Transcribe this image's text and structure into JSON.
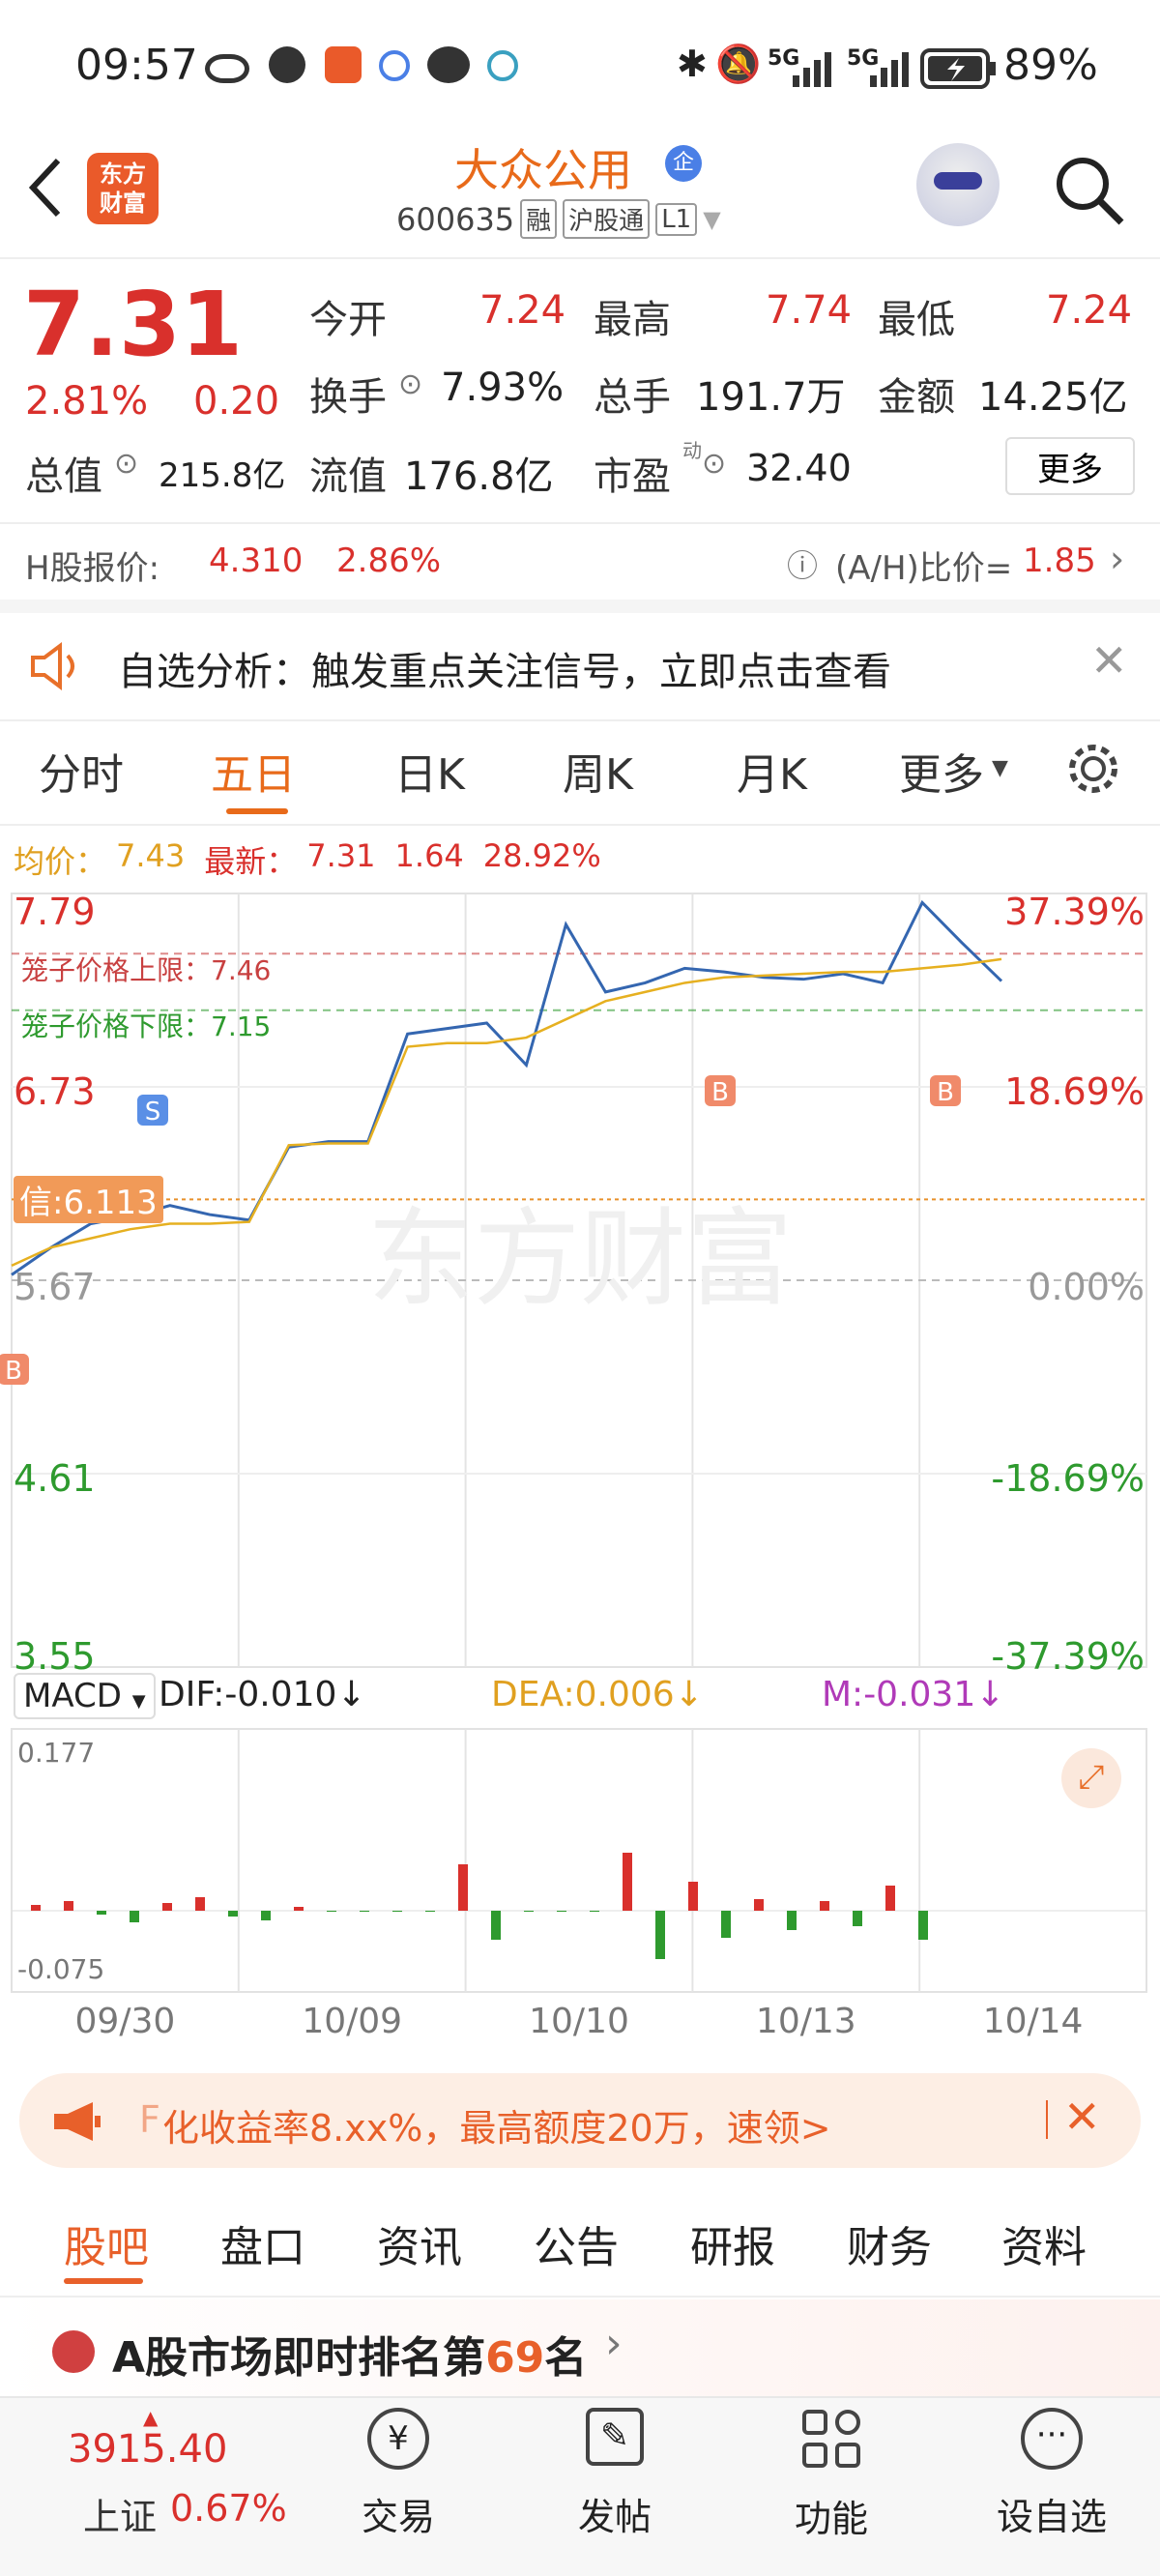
{
  "status_bar": {
    "time": "09:57",
    "battery": "89%",
    "signal1": "5G",
    "signal2": "5G"
  },
  "header": {
    "logo_text_1": "东方",
    "logo_text_2": "财富",
    "name": "大众公用",
    "name_badge": "企",
    "code": "600635",
    "tags": [
      "融",
      "沪股通",
      "L1"
    ]
  },
  "quote": {
    "price": "7.31",
    "change_pct": "2.81%",
    "change_abs": "0.20",
    "open_label": "今开",
    "open": "7.24",
    "high_label": "最高",
    "high": "7.74",
    "low_label": "最低",
    "low": "7.24",
    "turnover_label": "换手",
    "turnover": "7.93%",
    "volume_label": "总手",
    "volume": "191.7万",
    "amount_label": "金额",
    "amount": "14.25亿",
    "mktcap_label": "总值",
    "mktcap": "215.8亿",
    "float_label": "流值",
    "float": "176.8亿",
    "pe_label": "市盈",
    "pe_sup": "动",
    "pe": "32.40",
    "more_button": "更多"
  },
  "h_share": {
    "label": "H股报价:",
    "price": "4.310",
    "pct": "2.86%",
    "ratio_label": "(A/H)比价=",
    "ratio": "1.85"
  },
  "banner": {
    "text": "自选分析：触发重点关注信号，立即点击查看"
  },
  "tabs": {
    "items": [
      "分时",
      "五日",
      "日K",
      "周K",
      "月K",
      "更多"
    ],
    "active": 1
  },
  "chart_info": {
    "avg_label": "均价：",
    "avg": "7.43",
    "latest_label": "最新：",
    "latest": "7.31",
    "chg": "1.64",
    "pct": "28.92%"
  },
  "chart_data": {
    "type": "line",
    "days": [
      "09/30",
      "10/09",
      "10/10",
      "10/13",
      "10/14"
    ],
    "y_left_ticks": [
      "7.79",
      "6.73",
      "5.67",
      "4.61",
      "3.55"
    ],
    "y_right_ticks": [
      "37.39%",
      "18.69%",
      "0.00%",
      "-18.69%",
      "-37.39%"
    ],
    "ylim": [
      3.55,
      7.79
    ],
    "cage_upper_label": "笼子价格上限：",
    "cage_upper": "7.46",
    "cage_lower_label": "笼子价格下限：",
    "cage_lower": "7.15",
    "signal_label": "信:6.113",
    "watermark": "东方财富",
    "markers": [
      "S",
      "B",
      "B",
      "B"
    ],
    "series": [
      {
        "name": "price",
        "values": [
          5.7,
          5.85,
          5.98,
          6.02,
          6.08,
          6.03,
          6.0,
          6.4,
          6.43,
          6.43,
          7.02,
          7.05,
          7.08,
          6.85,
          7.62,
          7.25,
          7.3,
          7.38,
          7.36,
          7.33,
          7.32,
          7.35,
          7.3,
          7.74,
          7.52,
          7.31
        ]
      },
      {
        "name": "avg",
        "values": [
          5.75,
          5.85,
          5.9,
          5.95,
          5.98,
          5.98,
          5.99,
          6.41,
          6.42,
          6.42,
          6.95,
          6.97,
          6.97,
          7.0,
          7.1,
          7.2,
          7.25,
          7.3,
          7.33,
          7.34,
          7.35,
          7.36,
          7.36,
          7.38,
          7.4,
          7.43
        ]
      }
    ]
  },
  "macd": {
    "selector": "MACD",
    "dif": "DIF:-0.010",
    "dea": "DEA:0.006",
    "m": "M:-0.031",
    "top": "0.177",
    "bottom": "-0.075"
  },
  "ad_banner": {
    "text": "化收益率8.xx%，最高额度20万，速领>",
    "prefix": "F"
  },
  "sub_tabs": {
    "items": [
      "股吧",
      "盘口",
      "资讯",
      "公告",
      "研报",
      "财务",
      "资料"
    ],
    "active": 0
  },
  "rank": {
    "text_pre": "A股市场即时排名第",
    "rank": "69",
    "text_post": "名"
  },
  "bottom_nav": {
    "index_value": "3915.40",
    "index_name": "上证",
    "index_pct": "0.67%",
    "items": [
      "交易",
      "发帖",
      "功能",
      "设自选"
    ]
  }
}
